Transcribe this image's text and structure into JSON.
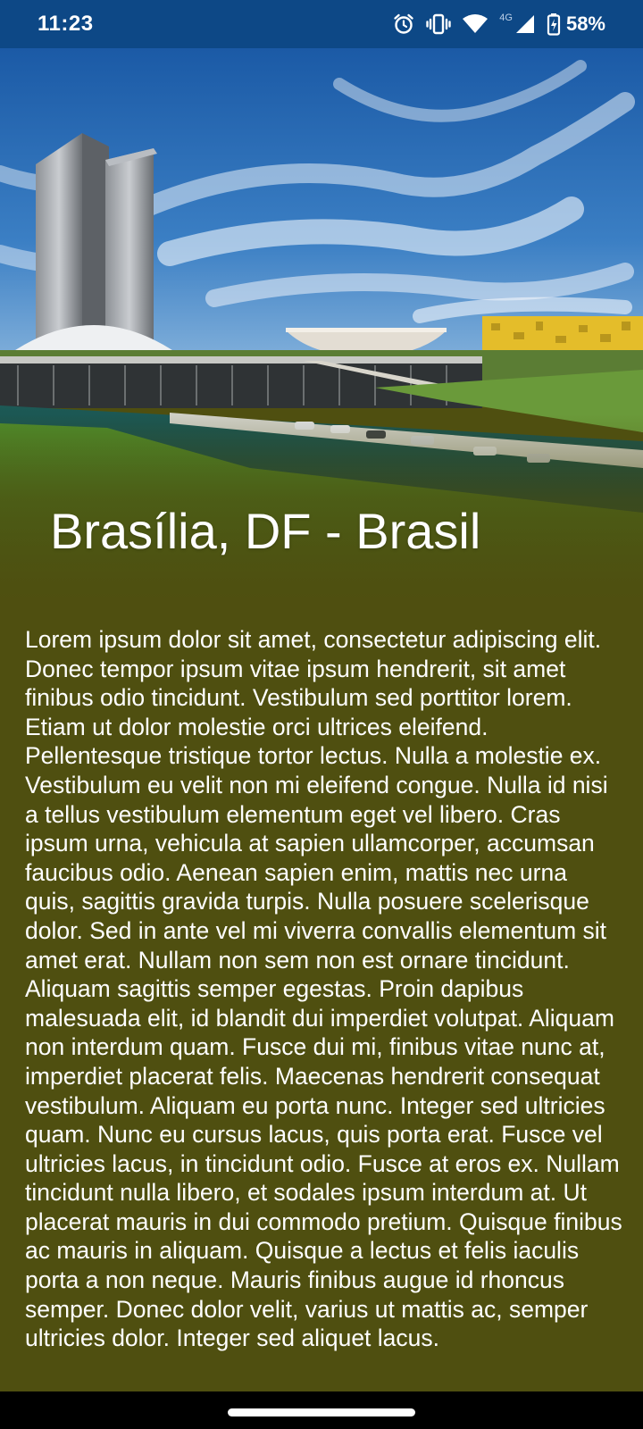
{
  "status_bar": {
    "time": "11:23",
    "network_label": "4G",
    "battery_percent": "58%",
    "icons": [
      "alarm-icon",
      "vibrate-icon",
      "wifi-icon",
      "signal-icon",
      "battery-icon"
    ]
  },
  "hero": {
    "title": "Brasília, DF - Brasil",
    "image": "brasilia-national-congress-photo"
  },
  "article": {
    "body": "Lorem ipsum dolor sit amet, consectetur adipiscing elit. Donec tempor ipsum vitae ipsum hendrerit, sit amet finibus odio tincidunt. Vestibulum sed porttitor lorem. Etiam ut dolor molestie orci ultrices eleifend. Pellentesque tristique tortor lectus. Nulla a molestie ex. Vestibulum eu velit non mi eleifend congue. Nulla id nisi a tellus vestibulum elementum eget vel libero. Cras ipsum urna, vehicula at sapien ullamcorper, accumsan faucibus odio. Aenean sapien enim, mattis nec urna quis, sagittis gravida turpis. Nulla posuere scelerisque dolor. Sed in ante vel mi viverra convallis elementum sit amet erat. Nullam non sem non est ornare tincidunt. Aliquam sagittis semper egestas. Proin dapibus malesuada elit, id blandit dui imperdiet volutpat. Aliquam non interdum quam. Fusce dui mi, finibus vitae nunc at, imperdiet placerat felis. Maecenas hendrerit consequat vestibulum. Aliquam eu porta nunc. Integer sed ultricies quam. Nunc eu cursus lacus, quis porta erat. Fusce vel ultricies lacus, in tincidunt odio. Fusce at eros ex. Nullam tincidunt nulla libero, et sodales ipsum interdum at. Ut placerat mauris in dui commodo pretium. Quisque finibus ac mauris in aliquam. Quisque a lectus et felis iaculis porta a non neque. Mauris finibus augue id rhoncus semper. Donec dolor velit, varius ut mattis ac, semper ultricies dolor. Integer sed aliquet lacus."
  },
  "colors": {
    "status_bar": "#0d4886",
    "background": "#4f4f10",
    "text": "#ffffff",
    "nav_bar": "#000000"
  }
}
